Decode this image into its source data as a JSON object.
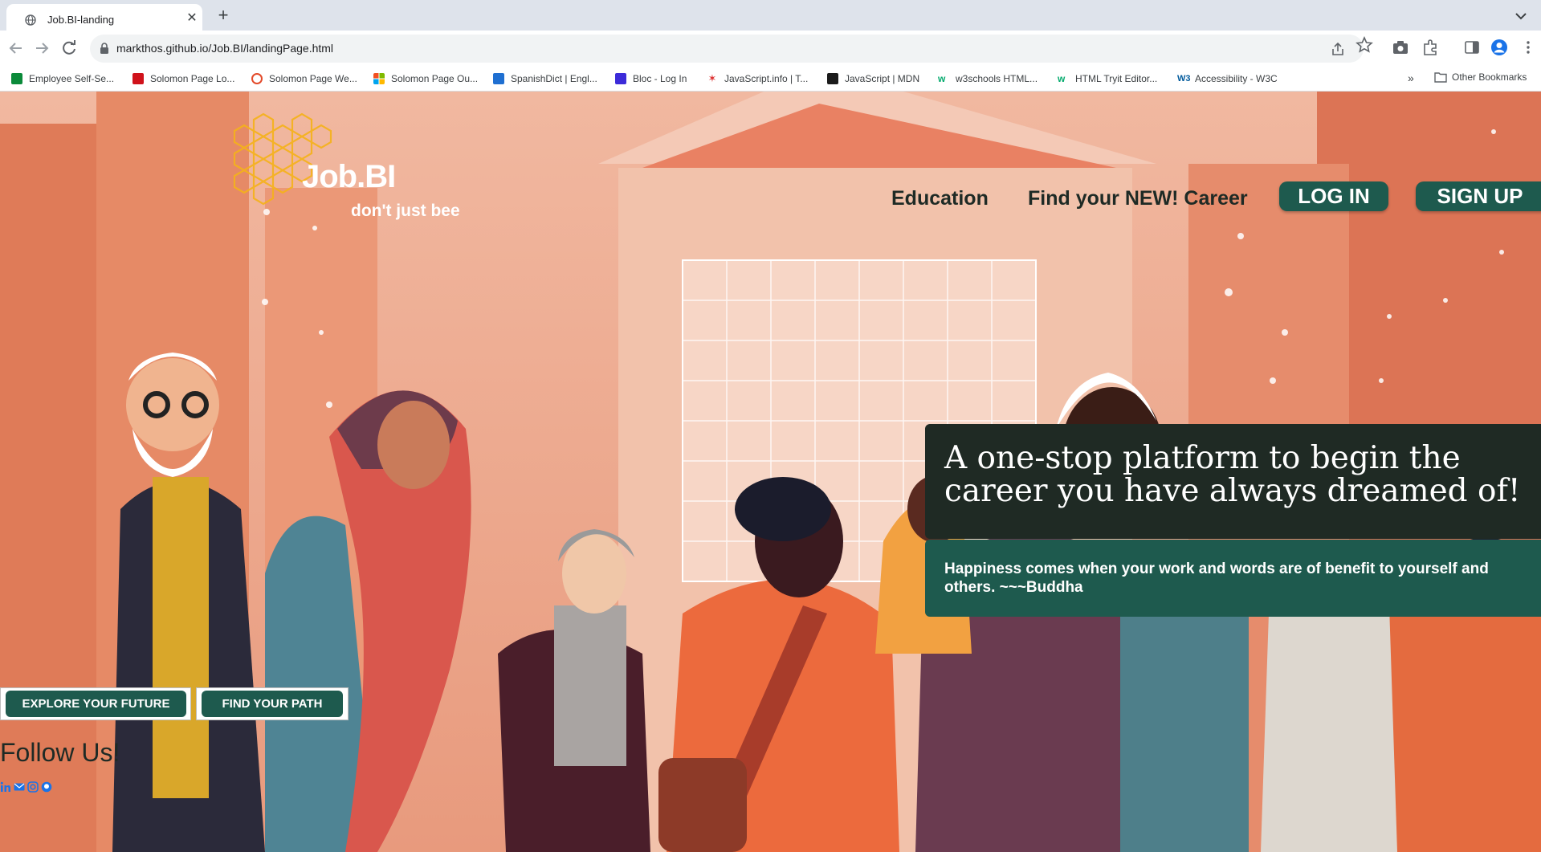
{
  "browser": {
    "tab_title": "Job.BI-landing",
    "url": "markthos.github.io/Job.BI/landingPage.html",
    "bookmarks": [
      {
        "label": "Employee Self-Se...",
        "icon": "ess-icon",
        "color": "#0b8a3a"
      },
      {
        "label": "Solomon Page Lo...",
        "icon": "adp-icon",
        "color": "#d0121b"
      },
      {
        "label": "Solomon Page We...",
        "icon": "webmail-icon",
        "color": "#e34b2b"
      },
      {
        "label": "Solomon Page Ou...",
        "icon": "microsoft-icon",
        "color": "#f25022"
      },
      {
        "label": "SpanishDict | Engl...",
        "icon": "spanishdict-icon",
        "color": "#1f6fd1"
      },
      {
        "label": "Bloc - Log In",
        "icon": "bloc-icon",
        "color": "#3c2bd9"
      },
      {
        "label": "JavaScript.info | T...",
        "icon": "javascript-info-icon",
        "color": "#d33"
      },
      {
        "label": "JavaScript | MDN",
        "icon": "mdn-icon",
        "color": "#1b1b1b"
      },
      {
        "label": "w3schools HTML...",
        "icon": "w3schools-icon",
        "color": "#04aa6d"
      },
      {
        "label": "HTML Tryit Editor...",
        "icon": "w3schools-tryit-icon",
        "color": "#04aa6d"
      },
      {
        "label": "Accessibility - W3C",
        "icon": "w3c-icon",
        "color": "#005a9c"
      }
    ],
    "more_symbol": "»",
    "other_bookmarks": "Other Bookmarks"
  },
  "brand": {
    "name": "Job.BI",
    "tagline": "don't just bee",
    "accent": "#f5b21a"
  },
  "nav": {
    "education": "Education",
    "career": "Find your NEW! Career",
    "login": "LOG IN",
    "signup": "SIGN UP"
  },
  "hero": {
    "headline": "A one-stop platform to begin the career you have always dreamed of!",
    "quote": "Happiness comes when your work and words are of benefit to yourself and others. ~~~Buddha"
  },
  "cta": {
    "explore": "EXPLORE YOUR FUTURE",
    "find_path": "FIND YOUR PATH"
  },
  "social": {
    "heading": "Follow Us!",
    "icons": [
      "linkedin-icon",
      "email-icon",
      "instagram-icon",
      "github-icon"
    ],
    "color": "#1a73e8"
  },
  "colors": {
    "primary_green": "#1e5a4e",
    "dark_panel": "#1f2a24",
    "hero_background": "#e8876a"
  }
}
